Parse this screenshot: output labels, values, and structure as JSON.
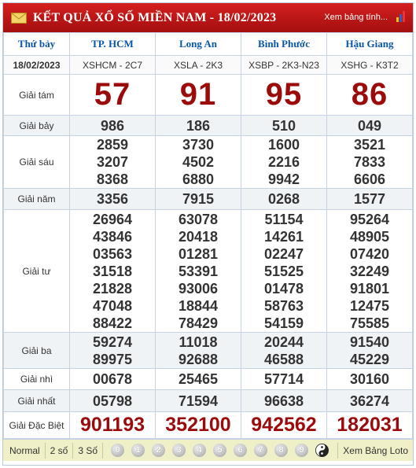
{
  "header": {
    "title": "KẾT QUẢ XỔ SỐ MIỀN NAM - 18/02/2023",
    "view_table_link": "Xem bảng tính..."
  },
  "provinces": {
    "day": "Thứ bảy",
    "date": "18/02/2023",
    "names": [
      "TP. HCM",
      "Long An",
      "Bình Phước",
      "Hậu Giang"
    ],
    "codes": [
      "XSHCM - 2C7",
      "XSLA - 2K3",
      "XSBP - 2K3-N23",
      "XSHG - K3T2"
    ]
  },
  "prizes": {
    "g8": {
      "label": "Giải tám",
      "values": [
        "57",
        "91",
        "95",
        "86"
      ]
    },
    "g7": {
      "label": "Giải bảy",
      "values": [
        "986",
        "186",
        "510",
        "049"
      ]
    },
    "g6": {
      "label": "Giải sáu",
      "values": [
        [
          "2859",
          "3207",
          "8368"
        ],
        [
          "3730",
          "4502",
          "6880"
        ],
        [
          "1600",
          "2216",
          "9942"
        ],
        [
          "3521",
          "7833",
          "6606"
        ]
      ]
    },
    "g5": {
      "label": "Giải năm",
      "values": [
        "3356",
        "7915",
        "0268",
        "1577"
      ]
    },
    "g4": {
      "label": "Giải tư",
      "values": [
        [
          "26964",
          "43846",
          "03563",
          "31518",
          "21828",
          "47048",
          "88422"
        ],
        [
          "63078",
          "20418",
          "01281",
          "53391",
          "93006",
          "18844",
          "78429"
        ],
        [
          "51154",
          "14261",
          "02247",
          "51525",
          "01478",
          "58763",
          "54159"
        ],
        [
          "95264",
          "48905",
          "07420",
          "32249",
          "91801",
          "12475",
          "75585"
        ]
      ]
    },
    "g3": {
      "label": "Giải ba",
      "values": [
        [
          "59274",
          "89975"
        ],
        [
          "11018",
          "92688"
        ],
        [
          "20244",
          "46588"
        ],
        [
          "91540",
          "45229"
        ]
      ]
    },
    "g2": {
      "label": "Giải nhì",
      "values": [
        "00678",
        "25465",
        "57714",
        "30160"
      ]
    },
    "g1": {
      "label": "Giải nhất",
      "values": [
        "05798",
        "71594",
        "96638",
        "36274"
      ]
    },
    "gdb": {
      "label": "Giải Đặc Biệt",
      "values": [
        "901193",
        "352100",
        "942562",
        "182031"
      ]
    }
  },
  "footer": {
    "tabs": [
      "Normal",
      "2 số",
      "3 Số"
    ],
    "digits": [
      "0",
      "1",
      "2",
      "3",
      "4",
      "5",
      "6",
      "7",
      "8",
      "9"
    ],
    "loto_link": "Xem Bảng Loto"
  },
  "colors": {
    "header_red": "#c41616",
    "province_blue": "#0a56a6",
    "prize_red": "#9b0b0b",
    "footer_bg": "#efefc8"
  }
}
